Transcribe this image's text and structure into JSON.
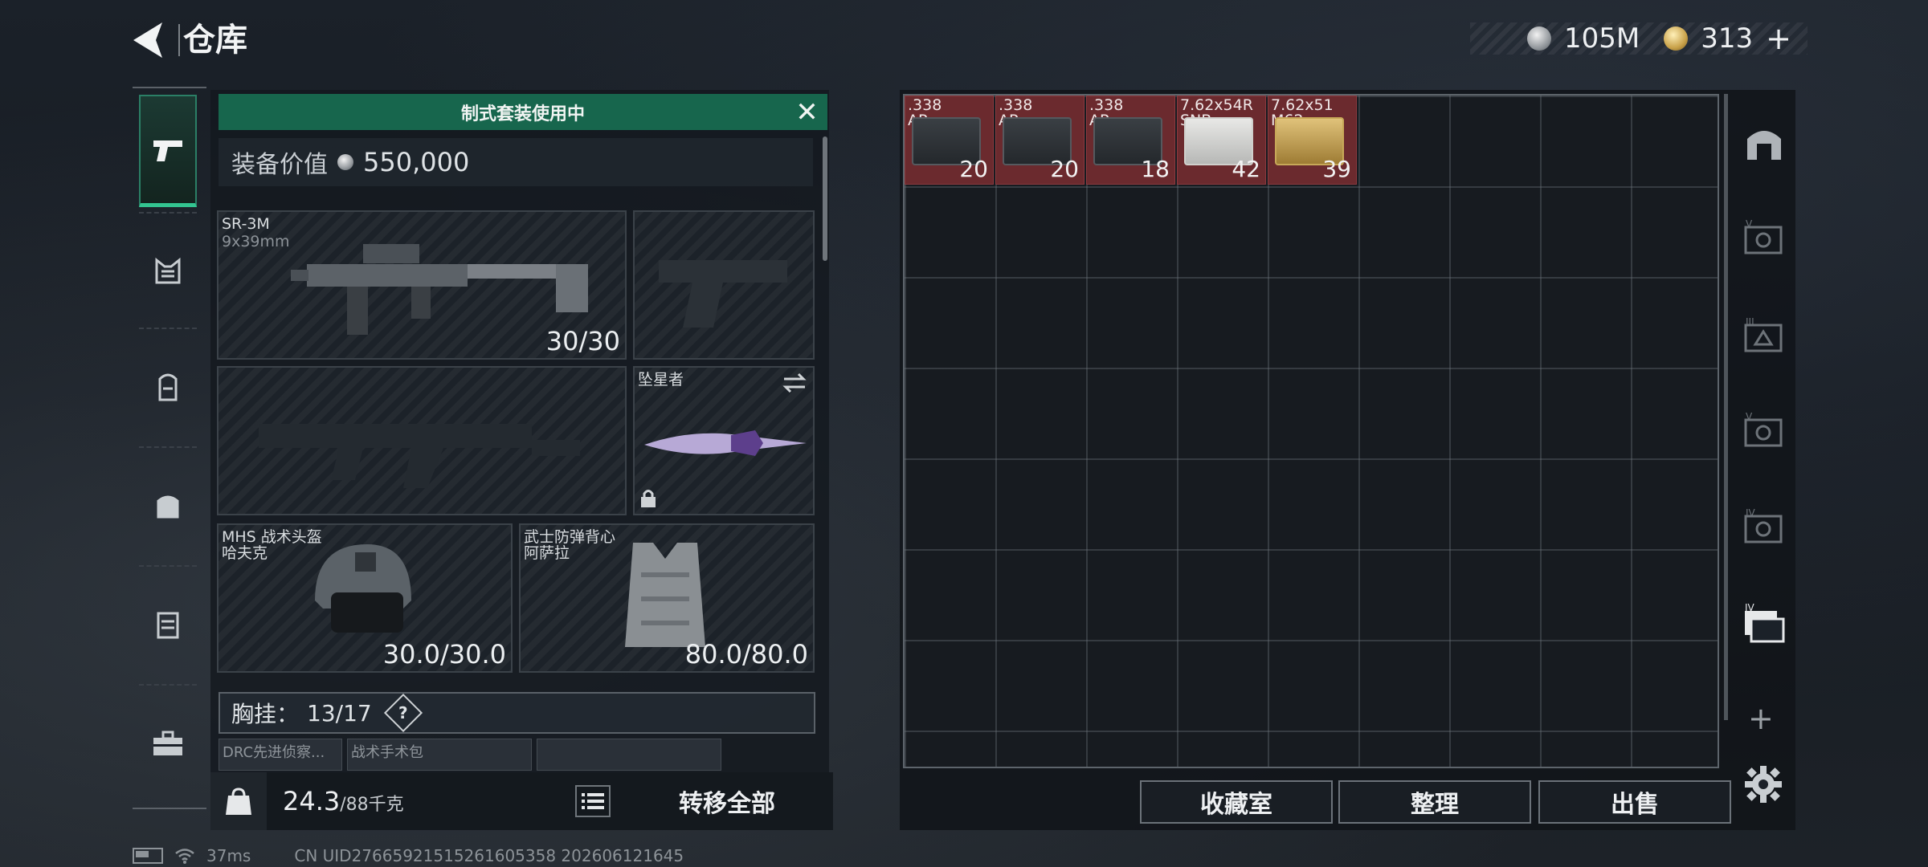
{
  "header": {
    "title": "仓库",
    "currency_silver": "105M",
    "currency_gold": "313",
    "gold_add_label": "+"
  },
  "loadout": {
    "banner": "制式套装使用中",
    "value_label": "装备价值",
    "value": "550,000",
    "primary_weapon": {
      "name": "SR-3M",
      "caliber": "9x39mm",
      "ammo": "30/30"
    },
    "melee": {
      "name": "坠星者"
    },
    "helmet": {
      "line1": "MHS 战术头盔",
      "line2": "哈夫克",
      "durability": "30.0/30.0"
    },
    "armor": {
      "line1": "武士防弹背心",
      "line2": "阿萨拉",
      "durability": "80.0/80.0"
    },
    "chest_rig": {
      "label": "胸挂：",
      "capacity": "13/17",
      "help": "?"
    },
    "mini_slots": [
      "DRC先进侦察...",
      "战术手术包",
      ""
    ],
    "weight": "24.3",
    "weight_max": "/88千克",
    "transfer_all": "转移全部"
  },
  "storage": {
    "items": [
      {
        "name_line1": ".338",
        "name_line2": "AP",
        "count": "20",
        "style": "dark"
      },
      {
        "name_line1": ".338",
        "name_line2": "AP",
        "count": "20",
        "style": "dark"
      },
      {
        "name_line1": ".338",
        "name_line2": "AP",
        "count": "18",
        "style": "dark"
      },
      {
        "name_line1": "7.62x54R",
        "name_line2": "SNB",
        "count": "42",
        "style": "white"
      },
      {
        "name_line1": "7.62x51",
        "name_line2": "M62",
        "count": "39",
        "style": "tan"
      }
    ],
    "buttons": {
      "collection": "收藏室",
      "sort": "整理",
      "sell": "出售"
    },
    "side_tabs": [
      "vault-icon",
      "case-v-icon",
      "case-iii-icon",
      "case-v-icon",
      "case-iv-icon",
      "case-iv-active-icon"
    ],
    "add_label": "+"
  },
  "status": {
    "ping": "37ms",
    "uid": "CN UID276659215152616053​58 202606121645"
  }
}
